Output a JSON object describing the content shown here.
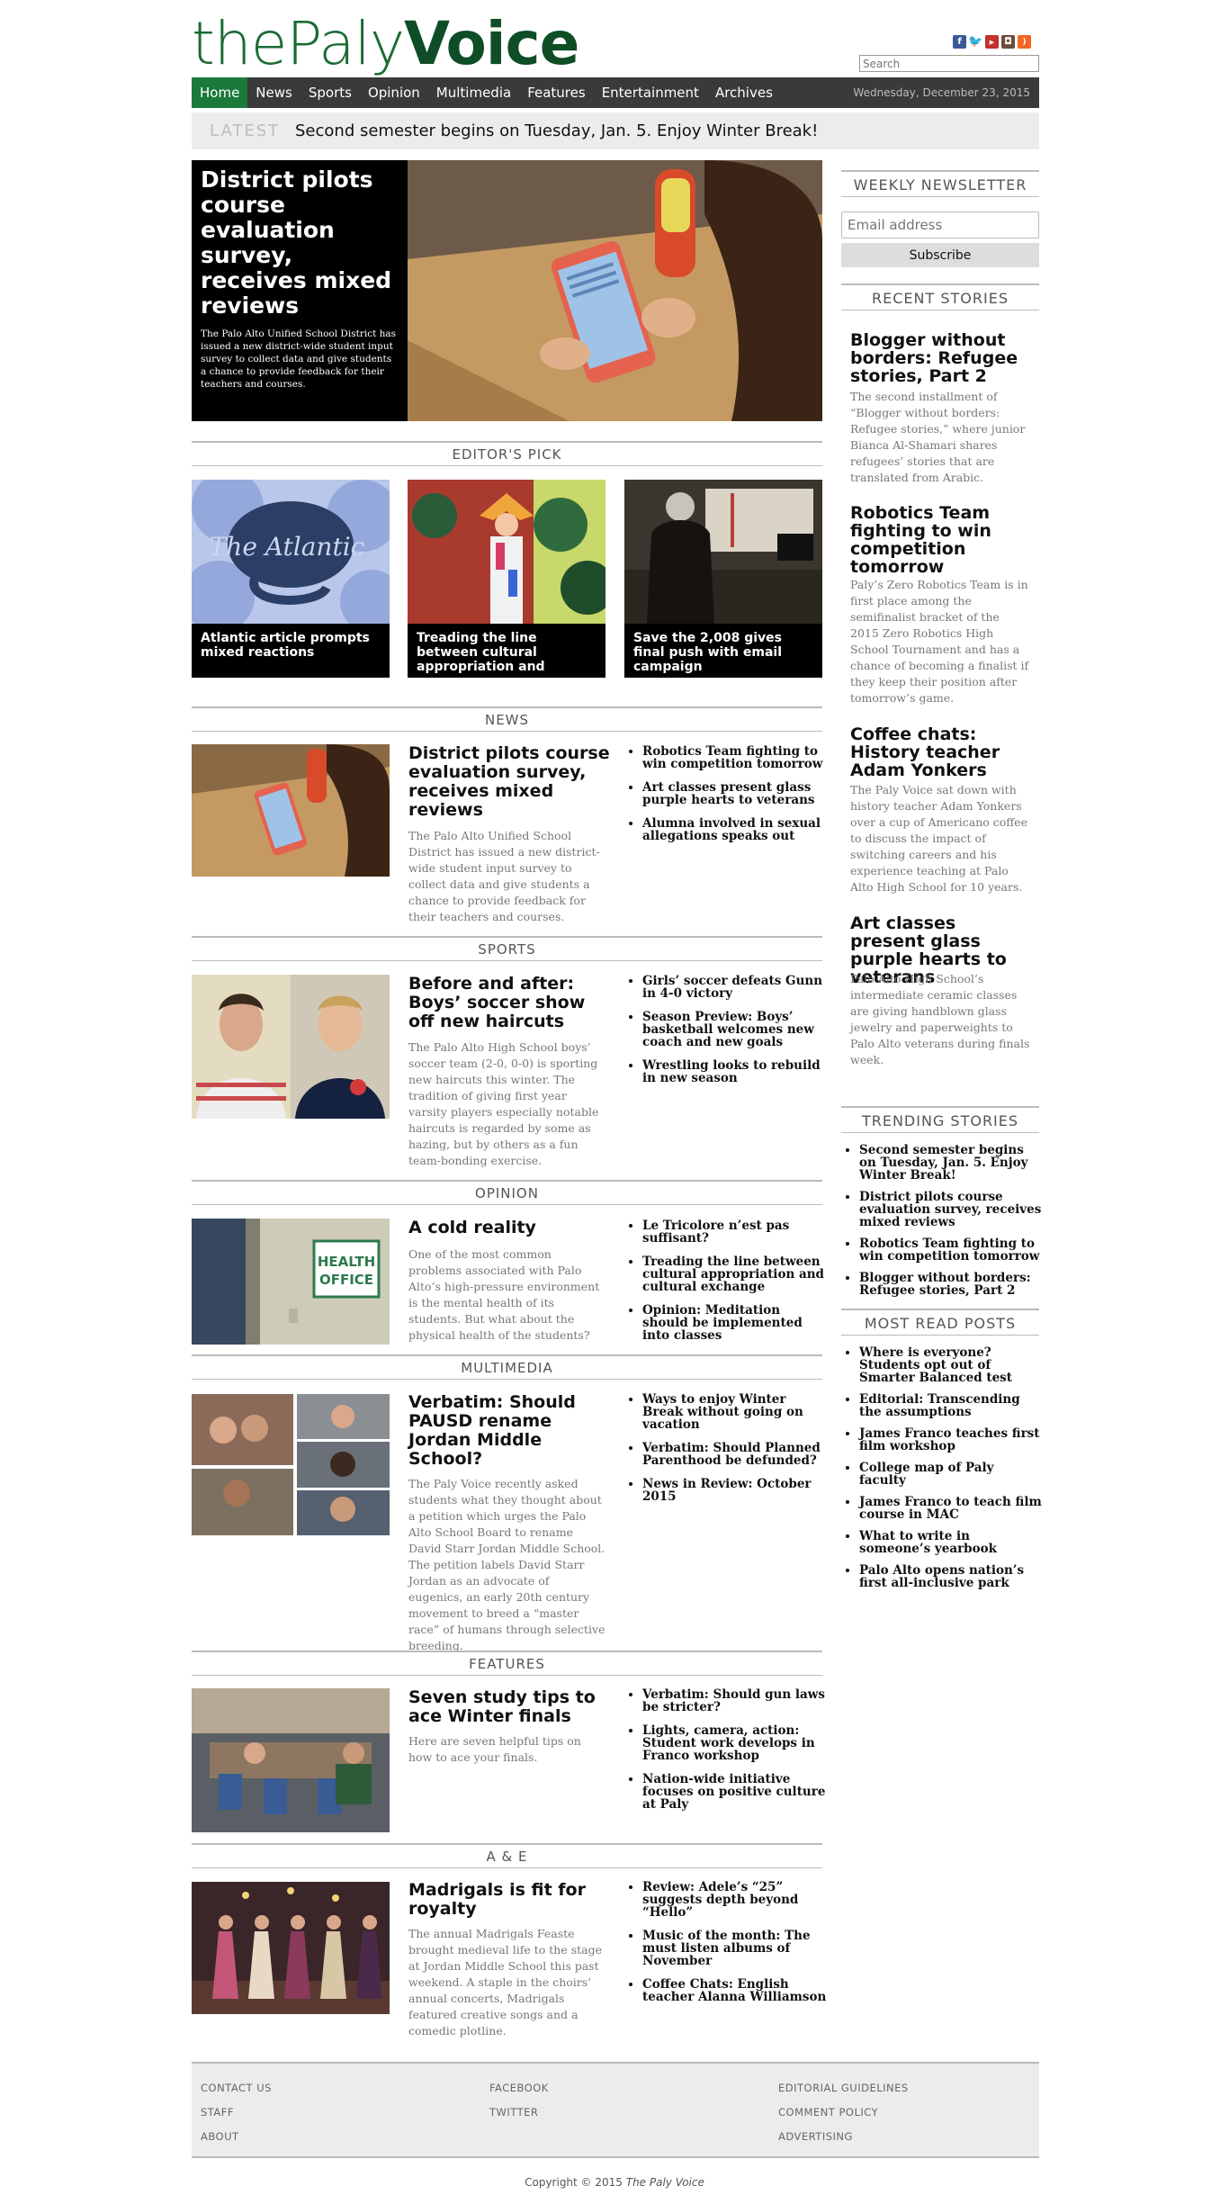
{
  "masthead": {
    "logo_the": "the",
    "logo_paly": "Paly",
    "logo_voice": "Voice",
    "search_placeholder": "Search"
  },
  "social": [
    "facebook-icon",
    "twitter-icon",
    "youtube-icon",
    "instagram-icon",
    "rss-icon"
  ],
  "nav": {
    "items": [
      "Home",
      "News",
      "Sports",
      "Opinion",
      "Multimedia",
      "Features",
      "Entertainment",
      "Archives"
    ],
    "date": "Wednesday, December 23, 2015"
  },
  "latest": {
    "label": "LATEST",
    "text": "Second semester begins on Tuesday, Jan. 5. Enjoy Winter Break!"
  },
  "hero": {
    "title": "District pilots course evaluation survey, receives mixed reviews",
    "desc": "The Palo Alto Unified School District has issued a new district-wide student input survey to collect data and give students a chance to provide feedback for their teachers and courses."
  },
  "editors_pick": {
    "heading": "EDITOR'S PICK",
    "items": [
      {
        "caption": "Atlantic article prompts mixed reactions",
        "image_text": "The Atlantic"
      },
      {
        "caption": "Treading the line between cultural appropriation and"
      },
      {
        "caption": "Save the 2,008 gives final push with email campaign"
      }
    ]
  },
  "news": {
    "heading": "NEWS",
    "title": "District pilots course evaluation survey, receives mixed reviews",
    "desc": "The Palo Alto Unified School District has issued a new district-wide student input survey to collect data and give students a chance to provide feedback for their teachers and courses.",
    "links": [
      "Robotics Team fighting to win competition tomorrow",
      "Art classes present glass purple hearts to veterans",
      "Alumna involved in sexual allegations speaks out"
    ]
  },
  "sports": {
    "heading": "SPORTS",
    "title": "Before and after: Boys’ soccer show off new haircuts",
    "desc": "The Palo Alto High School boys’ soccer team (2-0, 0-0) is sporting new haircuts this winter. The tradition of giving first year varsity players especially notable haircuts is regarded by some as hazing, but by others as a fun team-bonding exercise.",
    "links": [
      "Girls’ soccer defeats Gunn in 4-0 victory",
      "Season Preview: Boys’ basketball welcomes new coach and new goals",
      "Wrestling looks to rebuild in new season"
    ]
  },
  "opinion": {
    "heading": "OPINION",
    "title": "A cold reality",
    "desc": "One of the most common problems associated with Palo Alto’s high-pressure environment is the mental health of its students. But what about the physical health of the students?",
    "links": [
      "Le Tricolore n’est pas suffisant?",
      "Treading the line between cultural appropriation and cultural exchange",
      "Opinion: Meditation should be implemented into classes"
    ],
    "image_text": "HEALTH OFFICE"
  },
  "multimedia": {
    "heading": "MULTIMEDIA",
    "title": "Verbatim: Should PAUSD rename Jordan Middle School?",
    "desc": "The Paly Voice recently asked students what they thought about a petition which urges the Palo Alto School Board to rename David Starr Jordan Middle School. The petition labels David Starr Jordan as an advocate of eugenics, an early 20th century movement to breed a “master race” of humans through selective breeding.",
    "links": [
      "Ways to enjoy Winter Break without going on vacation",
      "Verbatim: Should Planned Parenthood be defunded?",
      "News in Review: October 2015"
    ]
  },
  "features": {
    "heading": "FEATURES",
    "title": "Seven study tips to ace Winter finals",
    "desc": "Here are seven helpful tips on how to ace your finals.",
    "links": [
      "Verbatim: Should gun laws be stricter?",
      "Lights, camera, action: Student work develops in Franco workshop",
      "Nation-wide initiative focuses on positive culture at Paly"
    ]
  },
  "ae": {
    "heading": "A & E",
    "title": "Madrigals is fit for royalty",
    "desc": "The annual Madrigals Feaste brought medieval life to the stage at Jordan Middle School this past weekend. A staple in the choirs’ annual concerts, Madrigals featured creative songs and a comedic plotline.",
    "links": [
      "Review: Adele’s “25” suggests depth beyond “Hello”",
      "Music of the month: The must listen albums of November",
      "Coffee Chats: English teacher Alanna Williamson"
    ]
  },
  "sidebar": {
    "newsletter_heading": "WEEKLY NEWSLETTER",
    "email_placeholder": "Email address",
    "subscribe_label": "Subscribe",
    "recent_heading": "RECENT STORIES",
    "recent": [
      {
        "title": "Blogger without borders: Refugee stories, Part 2",
        "desc": "The second installment of “Blogger without borders: Refugee stories,” where junior Bianca Al-Shamari shares refugees’ stories that are translated from Arabic."
      },
      {
        "title": "Robotics Team fighting to win competition tomorrow",
        "desc": "Paly’s Zero Robotics Team is in first place among the semifinalist bracket of the 2015 Zero Robotics High School Tournament and has a chance of becoming a finalist if they keep their position after tomorrow’s game."
      },
      {
        "title": "Coffee chats: History teacher Adam Yonkers",
        "desc": "The Paly Voice sat down with history teacher Adam Yonkers over a cup of Americano coffee to discuss the impact of switching careers and his experience teaching at Palo Alto High School for 10 years."
      },
      {
        "title": "Art classes present glass purple hearts to veterans",
        "desc": "Palo Alto High School’s intermediate ceramic classes are giving handblown glass jewelry and paperweights to Palo Alto veterans during finals week."
      }
    ],
    "trending_heading": "TRENDING STORIES",
    "trending": [
      "Second semester begins on Tuesday, Jan. 5. Enjoy Winter Break!",
      "District pilots course evaluation survey, receives mixed reviews",
      "Robotics Team fighting to win competition tomorrow",
      "Blogger without borders: Refugee stories, Part 2"
    ],
    "most_read_heading": "MOST READ POSTS",
    "most_read": [
      "Where is everyone? Students opt out of Smarter Balanced test",
      "Editorial: Transcending the assumptions",
      "James Franco teaches first film workshop",
      "College map of Paly faculty",
      "James Franco to teach film course in MAC",
      "What to write in someone’s yearbook",
      "Palo Alto opens nation’s first all-inclusive park"
    ]
  },
  "footer": {
    "col1": [
      "CONTACT US",
      "STAFF",
      "ABOUT"
    ],
    "col2": [
      "FACEBOOK",
      "TWITTER"
    ],
    "col3": [
      "EDITORIAL GUIDELINES",
      "COMMENT POLICY",
      "ADVERTISING"
    ],
    "copyright_prefix": "Copyright © 2015 ",
    "copyright_name": "The Paly Voice"
  },
  "colors": {
    "brand_green": "#1a6b35",
    "nav_bg": "#3a3a3a",
    "nav_active": "#1a7a3c"
  }
}
